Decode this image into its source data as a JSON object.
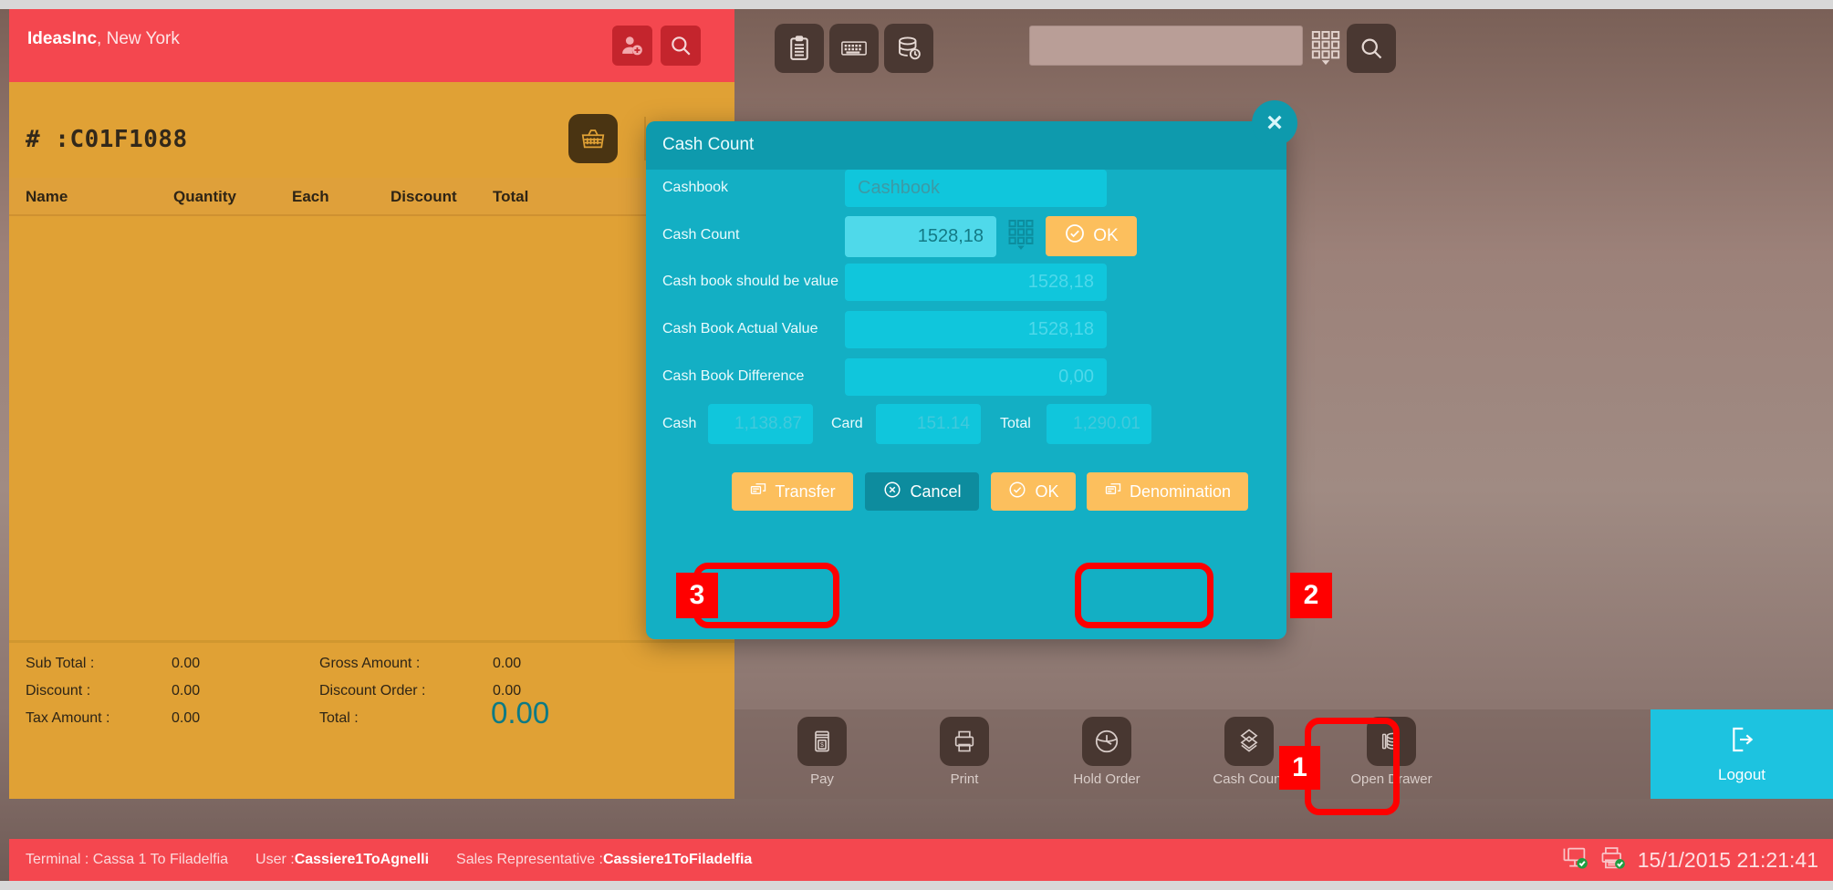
{
  "header": {
    "brand_name": "IdeasInc",
    "brand_location": ", New York",
    "add_customer_icon": "add-user-icon",
    "search_icon": "search-icon"
  },
  "toolbar": {
    "icons": [
      {
        "name": "clipboard-icon",
        "label": "Clipboard"
      },
      {
        "name": "keyboard-icon",
        "label": "Keyboard"
      },
      {
        "name": "database-refresh-icon",
        "label": "Refresh Database"
      }
    ],
    "search": {
      "value": "",
      "placeholder": ""
    },
    "keypad_icon": "numeric-keypad-icon",
    "search_button_icon": "search-icon"
  },
  "order": {
    "id": "# :C01F1088",
    "basket_icon": "basket-icon",
    "columns": [
      "Name",
      "Quantity",
      "Each",
      "Discount",
      "Total"
    ],
    "rows": [],
    "totals": {
      "sub_total_label": "Sub Total :",
      "sub_total_value": "0.00",
      "discount_label": "Discount :",
      "discount_value": "0.00",
      "tax_amount_label": "Tax Amount :",
      "tax_amount_value": "0.00",
      "gross_amount_label": "Gross Amount :",
      "gross_amount_value": "0.00",
      "discount_order_label": "Discount Order :",
      "discount_order_value": "0.00",
      "total_label": "Total :",
      "total_value": "0.00"
    }
  },
  "actions": [
    {
      "label": "Pay",
      "icon": "cash-register-icon"
    },
    {
      "label": "Print",
      "icon": "printer-icon"
    },
    {
      "label": "Hold Order",
      "icon": "clock-icon"
    },
    {
      "label": "Cash Count",
      "icon": "stacked-diamonds-icon"
    },
    {
      "label": "Open Drawer",
      "icon": "coins-icon"
    }
  ],
  "logout": {
    "label": "Logout",
    "icon": "logout-icon"
  },
  "status": {
    "terminal_label": "Terminal : ",
    "terminal_value": "Cassa 1 To Filadelfia",
    "user_label": "User :",
    "user_value": "Cassiere1ToAgnelli",
    "sales_rep_label": "Sales Representative :",
    "sales_rep_value": "Cassiere1ToFiladelfia",
    "datetime": "15/1/2015 21:21:41",
    "display_icon": "display-connected-icon",
    "printer_icon": "printer-connected-icon"
  },
  "modal": {
    "title": "Cash Count",
    "close_icon": "close-icon",
    "fields": [
      {
        "label": "Cashbook",
        "value": "Cashbook",
        "is_placeholder": true
      },
      {
        "label": "Cash Count",
        "value": "1528,18",
        "is_placeholder": false
      },
      {
        "label": "Cash book should be value",
        "value": "1528,18",
        "is_placeholder": false
      },
      {
        "label": "Cash Book Actual Value",
        "value": "1528,18",
        "is_placeholder": false
      },
      {
        "label": "Cash Book Difference",
        "value": "0,00",
        "is_placeholder": false
      }
    ],
    "keypad_icon": "numeric-keypad-icon",
    "inline_ok_label": "OK",
    "summary": [
      {
        "label": "Cash",
        "value": "1,138.87"
      },
      {
        "label": "Card",
        "value": "151.14"
      },
      {
        "label": "Total",
        "value": "1,290.01"
      }
    ],
    "buttons": [
      {
        "label": "Transfer",
        "icon": "transfer-icon",
        "style": "orange"
      },
      {
        "label": "Cancel",
        "icon": "cancel-icon",
        "style": "teal"
      },
      {
        "label": "OK",
        "icon": "check-icon",
        "style": "orange"
      },
      {
        "label": "Denomination",
        "icon": "transfer-icon",
        "style": "orange"
      }
    ]
  },
  "annotations": [
    {
      "number": "1",
      "target": "cash-count-action-button"
    },
    {
      "number": "2",
      "target": "denomination-button"
    },
    {
      "number": "3",
      "target": "transfer-button"
    }
  ],
  "colors": {
    "brand_red": "#f4474f",
    "panel_orange": "#e0a135",
    "modal_teal": "#13afc4",
    "accent_orange": "#fcbf5d",
    "logout_cyan": "#1dc3e0",
    "annotation_red": "#ff0000"
  }
}
